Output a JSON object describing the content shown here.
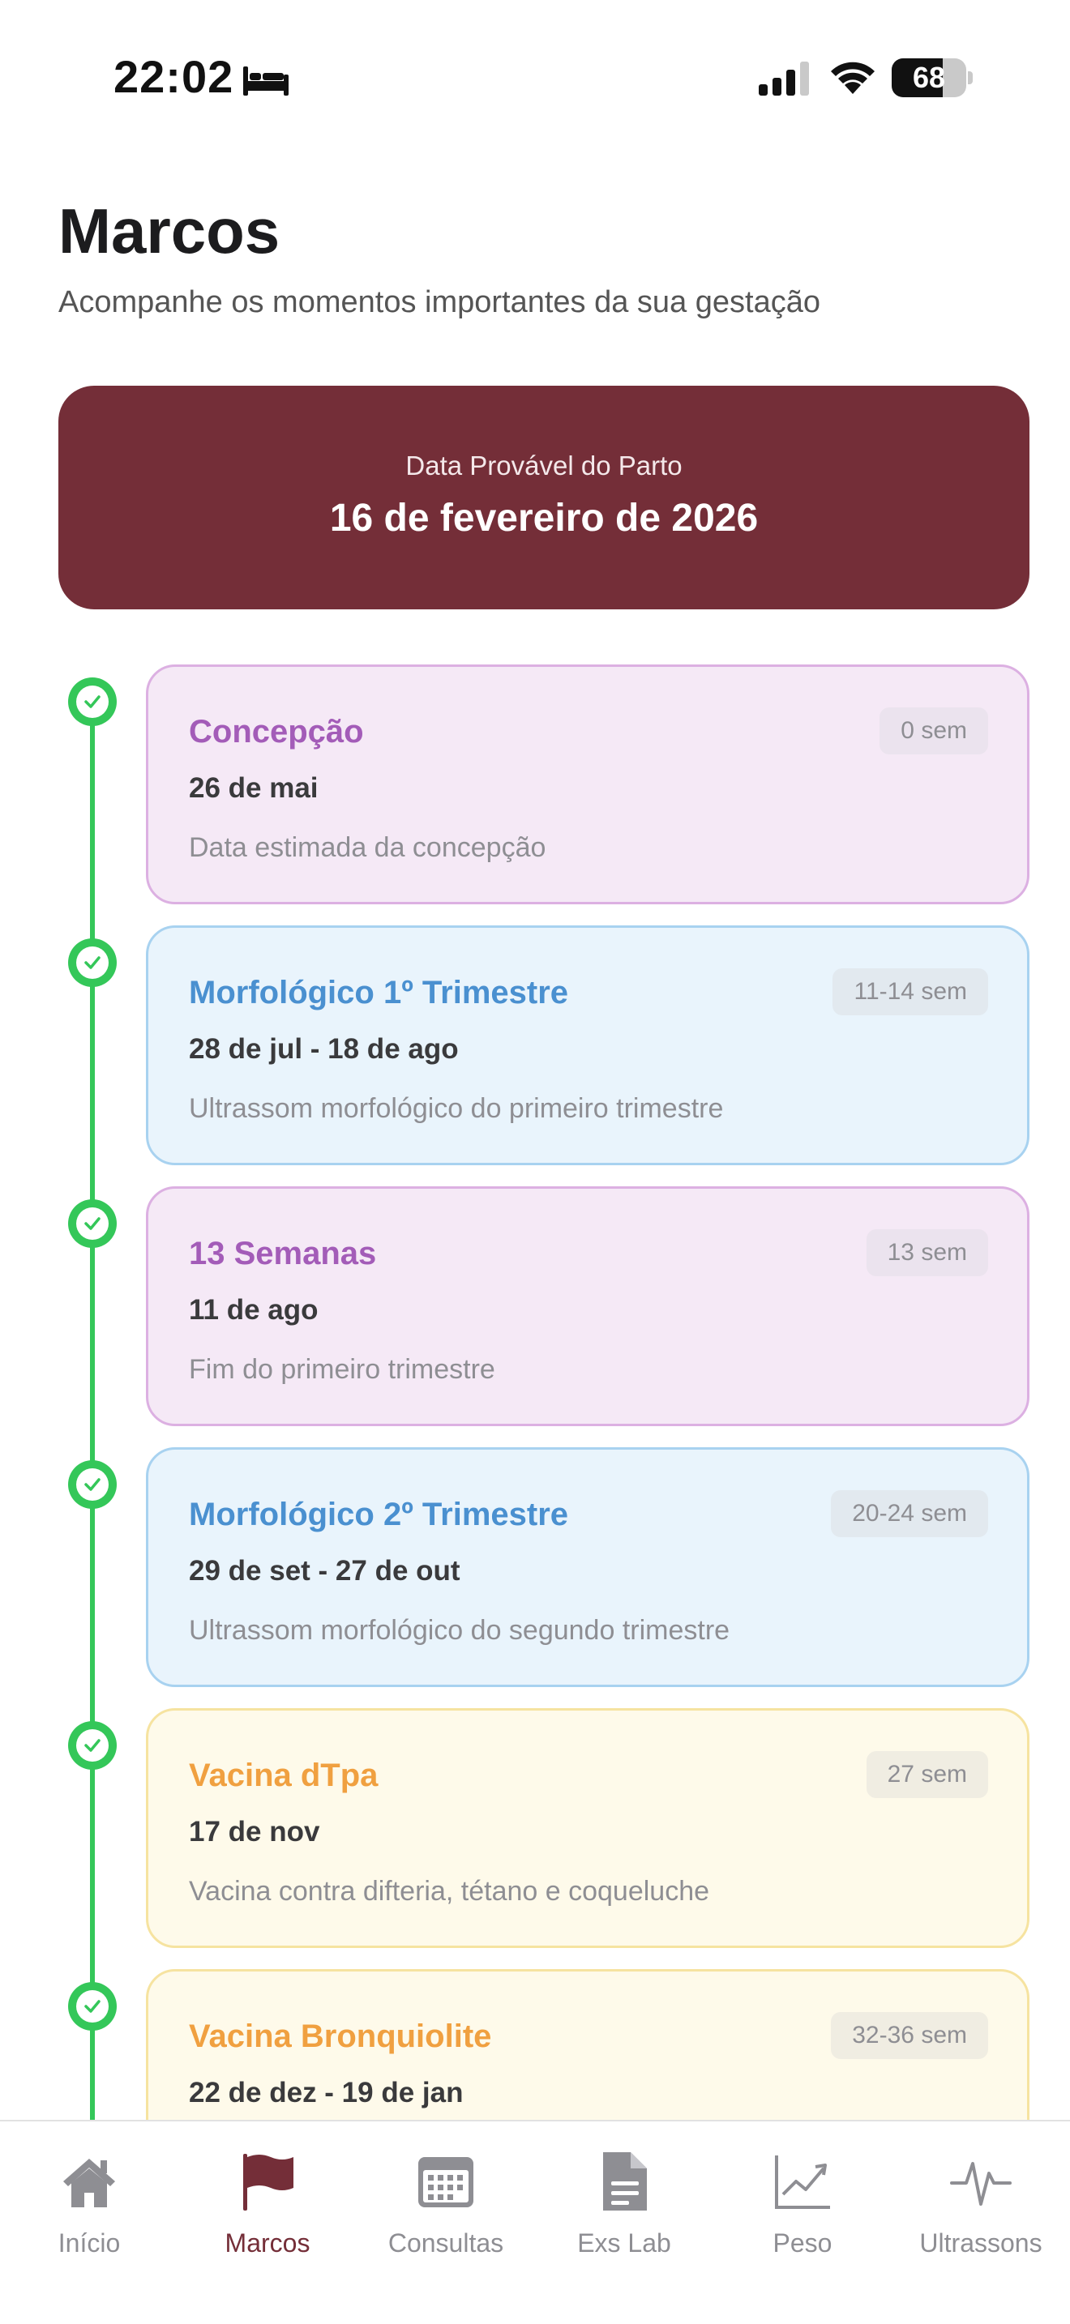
{
  "status_bar": {
    "time": "22:02",
    "battery_level": "68",
    "battery_fraction": 0.68,
    "icons": [
      "bed-icon",
      "cellular-signal-icon",
      "wifi-icon",
      "battery-icon"
    ]
  },
  "header": {
    "title": "Marcos",
    "subtitle": "Acompanhe os momentos importantes da sua gestação"
  },
  "due_date": {
    "label": "Data Provável do Parto",
    "value": "16 de fevereiro de 2026",
    "color": "#742e38"
  },
  "milestones": [
    {
      "title": "Concepção",
      "weeks": "0 sem",
      "date": "26 de mai",
      "description": "Data estimada da concepção",
      "theme": "purple",
      "completed": true
    },
    {
      "title": "Morfológico 1º Trimestre",
      "weeks": "11-14 sem",
      "date": "28 de jul - 18 de ago",
      "description": "Ultrassom morfológico do primeiro trimestre",
      "theme": "blue",
      "completed": true
    },
    {
      "title": "13 Semanas",
      "weeks": "13 sem",
      "date": "11 de ago",
      "description": "Fim do primeiro trimestre",
      "theme": "purple",
      "completed": true
    },
    {
      "title": "Morfológico 2º Trimestre",
      "weeks": "20-24 sem",
      "date": "29 de set - 27 de out",
      "description": "Ultrassom morfológico do segundo trimestre",
      "theme": "blue",
      "completed": true
    },
    {
      "title": "Vacina dTpa",
      "weeks": "27 sem",
      "date": "17 de nov",
      "description": "Vacina contra difteria, tétano e coqueluche",
      "theme": "yellow",
      "completed": true
    },
    {
      "title": "Vacina Bronquiolite",
      "weeks": "32-36 sem",
      "date": "22 de dez - 19 de jan",
      "description": "",
      "theme": "yellow",
      "completed": true
    }
  ],
  "colors": {
    "accent": "#742e38",
    "completed": "#34c759",
    "purple_title": "#a35cb8",
    "blue_title": "#4a90d0",
    "yellow_title": "#f0a040"
  },
  "tab_bar": {
    "active": "Marcos",
    "tabs": [
      {
        "label": "Início",
        "icon": "home-icon"
      },
      {
        "label": "Marcos",
        "icon": "flag-icon"
      },
      {
        "label": "Consultas",
        "icon": "calendar-icon"
      },
      {
        "label": "Exs Lab",
        "icon": "document-icon"
      },
      {
        "label": "Peso",
        "icon": "chart-line-icon"
      },
      {
        "label": "Ultrassons",
        "icon": "waveform-icon"
      }
    ]
  }
}
